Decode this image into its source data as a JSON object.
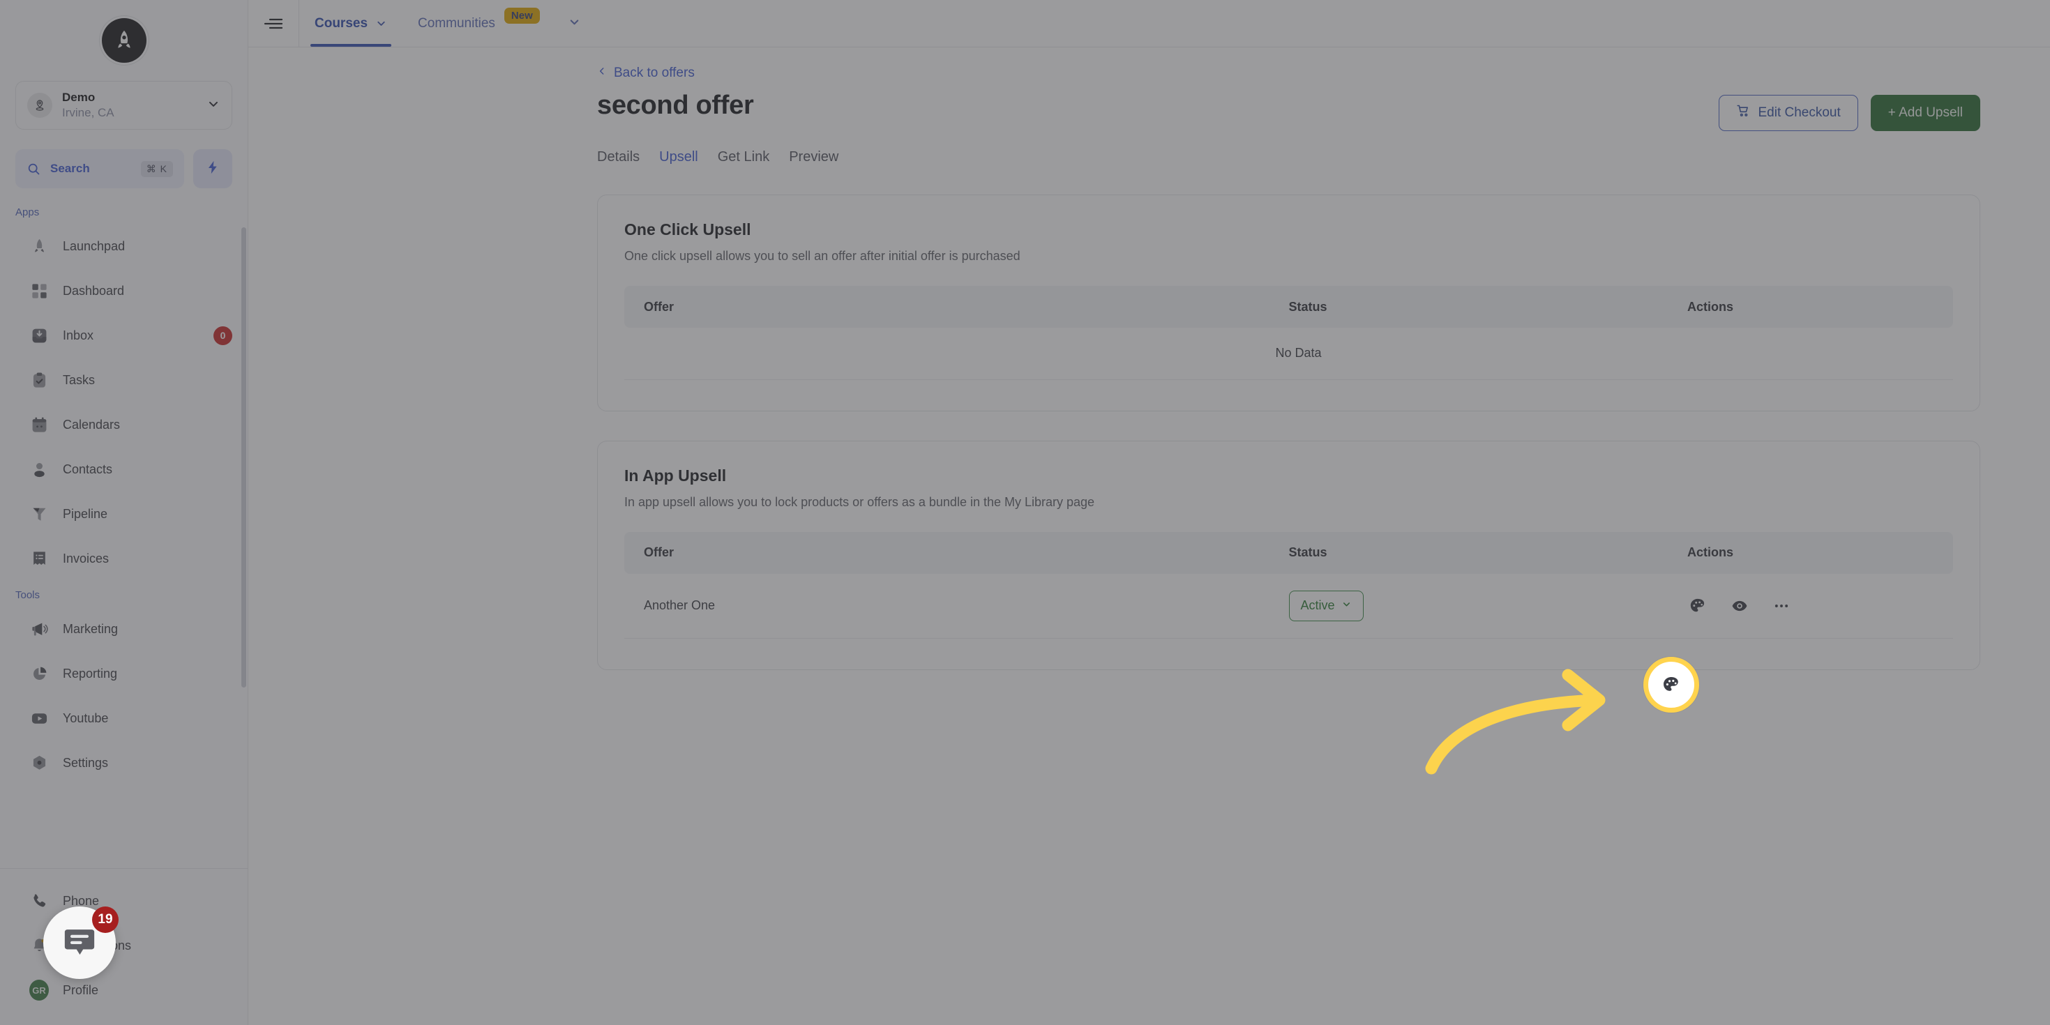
{
  "brand": {
    "logo_icon": "rocket-logo-icon",
    "accent_blue": "#3f5bd1",
    "accent_green": "#2a6b33",
    "highlight_yellow": "#ffd34d",
    "badge_red": "#c62828"
  },
  "sidebar": {
    "org": {
      "name": "Demo",
      "location": "Irvine, CA",
      "avatar_icon": "location-pin-icon",
      "chevron_icon": "chevron-down-icon"
    },
    "search": {
      "label": "Search",
      "shortcut": "⌘ K",
      "icon": "search-icon",
      "bolt_icon": "lightning-bolt-icon"
    },
    "groups": [
      {
        "label": "Apps",
        "items": [
          {
            "label": "Launchpad",
            "icon": "rocket-icon",
            "badge": ""
          },
          {
            "label": "Dashboard",
            "icon": "grid-squares-icon",
            "badge": ""
          },
          {
            "label": "Inbox",
            "icon": "inbox-tray-icon",
            "badge": "0"
          },
          {
            "label": "Tasks",
            "icon": "clipboard-check-icon",
            "badge": ""
          },
          {
            "label": "Calendars",
            "icon": "calendar-icon",
            "badge": ""
          },
          {
            "label": "Contacts",
            "icon": "person-icon",
            "badge": ""
          },
          {
            "label": "Pipeline",
            "icon": "funnel-icon",
            "badge": ""
          },
          {
            "label": "Invoices",
            "icon": "invoice-list-icon",
            "badge": ""
          }
        ]
      },
      {
        "label": "Tools",
        "items": [
          {
            "label": "Marketing",
            "icon": "megaphone-icon",
            "badge": ""
          },
          {
            "label": "Reporting",
            "icon": "pie-chart-icon",
            "badge": ""
          },
          {
            "label": "Youtube",
            "icon": "youtube-play-icon",
            "badge": ""
          },
          {
            "label": "Settings",
            "icon": "gear-hex-icon",
            "badge": ""
          }
        ]
      }
    ],
    "footer_items": [
      {
        "label": "Phone",
        "icon": "phone-icon",
        "badge": ""
      },
      {
        "label": "Notifications",
        "icon": "bell-icon",
        "badge": ""
      },
      {
        "label": "Profile",
        "icon": "avatar-initials",
        "initials": "GR",
        "badge": ""
      }
    ]
  },
  "topbar": {
    "collapse_icon": "sidebar-collapse-icon",
    "nav": [
      {
        "label": "Courses",
        "active": true,
        "chevron_icon": "chevron-down-icon",
        "badge": ""
      },
      {
        "label": "Communities",
        "active": false,
        "chevron_icon": "",
        "badge": "New"
      }
    ],
    "overflow_chevron_icon": "chevron-down-icon"
  },
  "page": {
    "back_link": "Back to offers",
    "back_icon": "chevron-left-icon",
    "title": "second offer",
    "buttons": {
      "edit_checkout": "Edit Checkout",
      "edit_checkout_icon": "shopping-cart-icon",
      "add_upsell": "+  Add Upsell"
    },
    "tabs": [
      {
        "label": "Details",
        "active": false
      },
      {
        "label": "Upsell",
        "active": true
      },
      {
        "label": "Get Link",
        "active": false
      },
      {
        "label": "Preview",
        "active": false
      }
    ]
  },
  "one_click_upsell": {
    "title": "One Click Upsell",
    "subtitle": "One click upsell allows you to sell an offer after initial offer is purchased",
    "columns": [
      "Offer",
      "Status",
      "Actions"
    ],
    "empty_text": "No Data",
    "rows": []
  },
  "in_app_upsell": {
    "title": "In App Upsell",
    "subtitle": "In app upsell allows you to lock products or offers as a bundle in the My Library page",
    "columns": [
      "Offer",
      "Status",
      "Actions"
    ],
    "rows": [
      {
        "offer": "Another One",
        "status": "Active",
        "status_chevron_icon": "chevron-down-icon",
        "actions": [
          "palette-icon",
          "eye-icon",
          "ellipsis-icon"
        ]
      }
    ]
  },
  "annotation": {
    "highlight_icon": "palette-icon",
    "arrow_icon": "curved-arrow-icon"
  },
  "chat_widget": {
    "icon": "chat-bubble-icon",
    "unread_count": "19"
  }
}
